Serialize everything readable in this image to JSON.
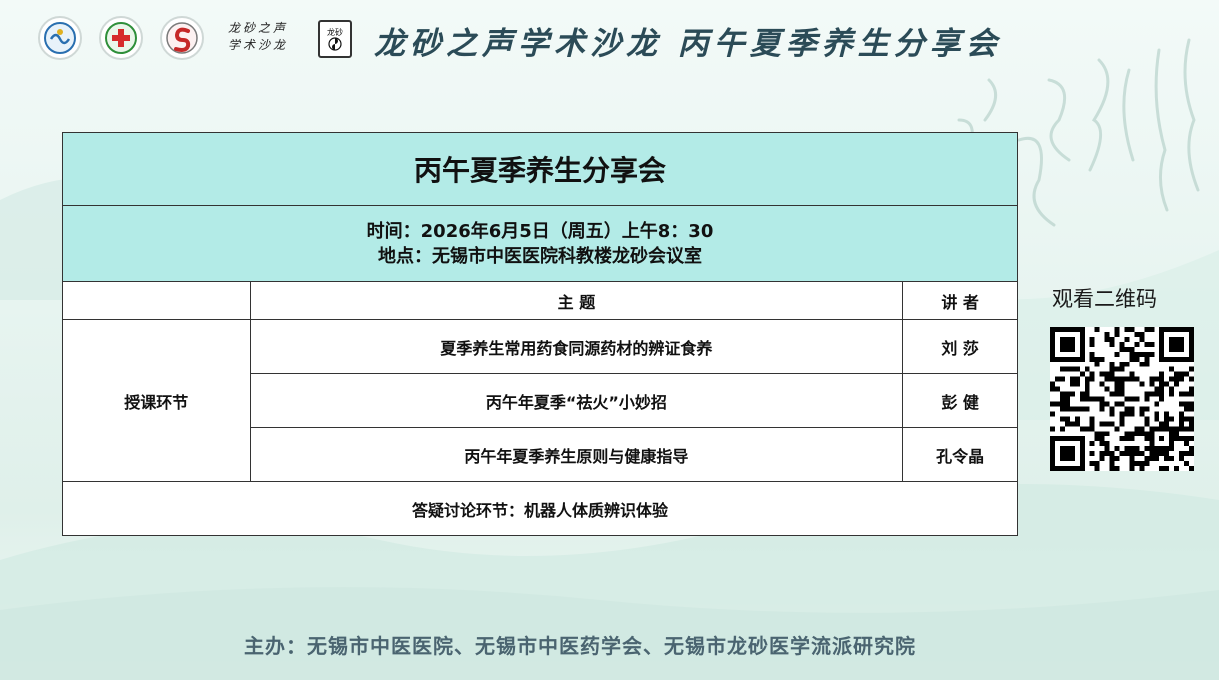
{
  "header": {
    "logos": [
      "logo-association",
      "logo-hospital",
      "logo-society"
    ],
    "salon_mini_line1": "龙砂之声",
    "salon_mini_line2": "学术沙龙",
    "badge_text": "龙砂",
    "title": "龙砂之声学术沙龙  丙午夏季养生分享会"
  },
  "schedule": {
    "title": "丙午夏季养生分享会",
    "time": "时间：2026年6月5日（周五）上午8：30",
    "place": "地点：无锡市中医医院科教楼龙砂会议室",
    "col_topic": "主  题",
    "col_speaker": "讲 者",
    "section_label": "授课环节",
    "items": [
      {
        "topic": "夏季养生常用药食同源药材的辨证食养",
        "speaker": "刘  莎"
      },
      {
        "topic": "丙午年夏季“祛火”小妙招",
        "speaker": "彭  健"
      },
      {
        "topic": "丙午年夏季养生原则与健康指导",
        "speaker": "孔令晶"
      }
    ],
    "qa": "答疑讨论环节：机器人体质辨识体验"
  },
  "qr": {
    "label": "观看二维码",
    "icon": "qr-code-icon"
  },
  "footer": {
    "organizers": "主办：无锡市中医医院、无锡市中医药学会、无锡市龙砂医学流派研究院"
  },
  "colors": {
    "table_header_bg": "#b3ebe7",
    "title_color": "#2b4b57",
    "footer_color": "#4a6470"
  }
}
